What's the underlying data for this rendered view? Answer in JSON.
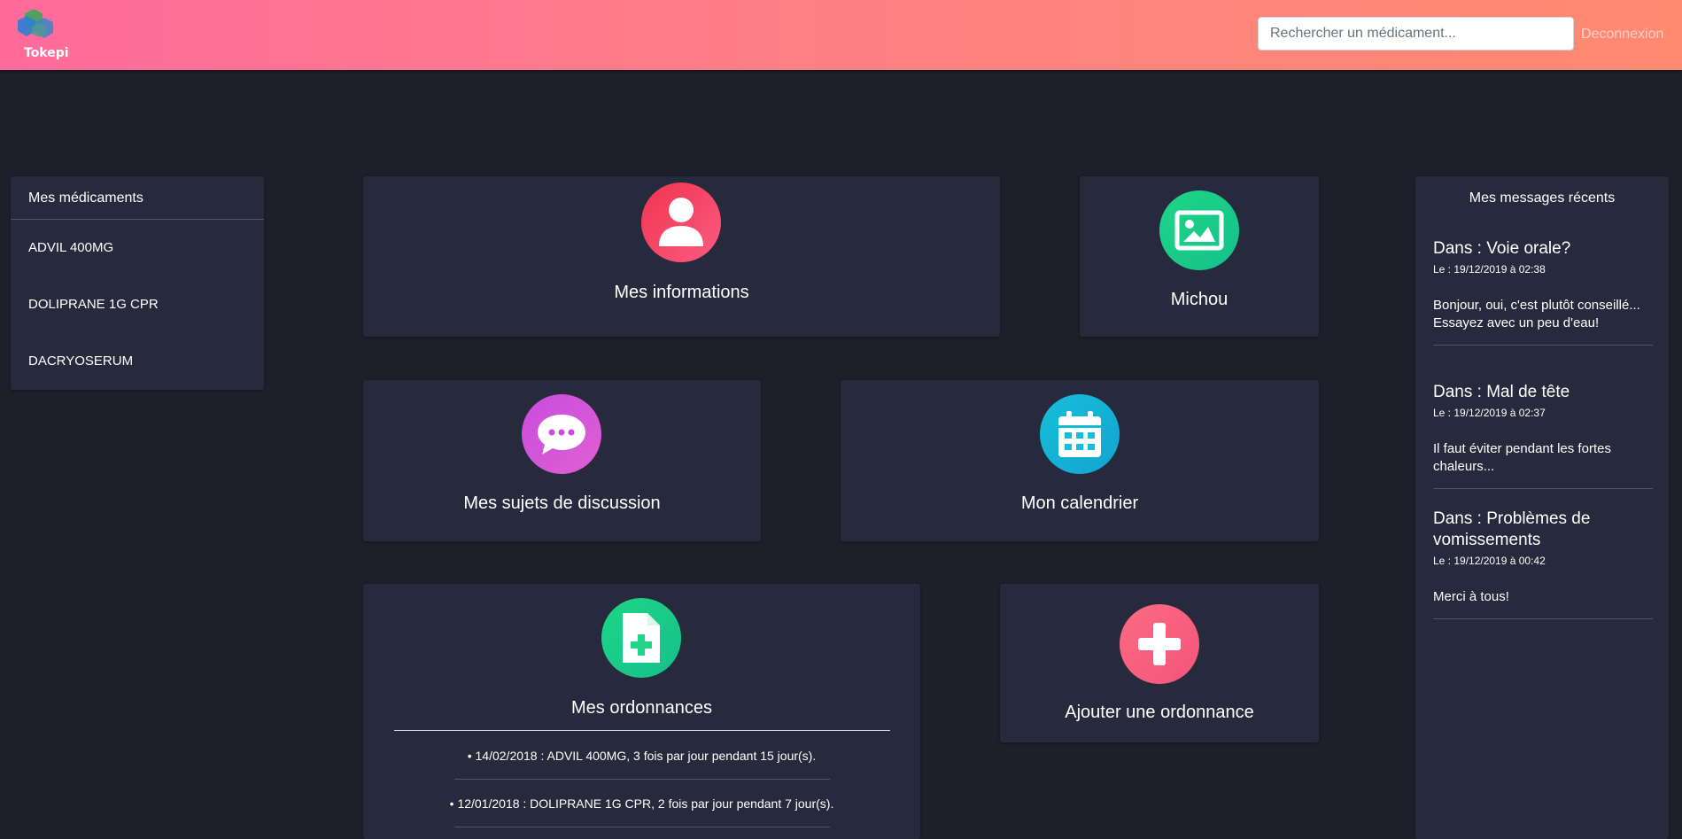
{
  "header": {
    "app_name": "Tokepi",
    "search_placeholder": "Rechercher un médicament...",
    "logout_label": "Deconnexion",
    "gradient_colors": [
      "#ff6a9b",
      "#ff8a70"
    ]
  },
  "medications": {
    "title": "Mes médicaments",
    "items": [
      "ADVIL 400MG",
      "DOLIPRANE 1G CPR",
      "DACRYOSERUM"
    ]
  },
  "tiles": {
    "informations": {
      "label": "Mes informations",
      "icon": "user-icon",
      "color": "#f0344f"
    },
    "profile": {
      "label": "Michou",
      "icon": "image-icon",
      "color": "#1ed685"
    },
    "topics": {
      "label": "Mes sujets de discussion",
      "icon": "chat-bubble-icon",
      "color": "#c84ce0"
    },
    "calendar": {
      "label": "Mon calendrier",
      "icon": "calendar-icon",
      "color": "#16bfd8"
    },
    "prescriptions": {
      "label": "Mes ordonnances",
      "icon": "prescription-file-icon",
      "color": "#1ed685",
      "items": [
        "• 14/02/2018 : ADVIL 400MG, 3 fois par jour pendant 15 jour(s).",
        "• 12/01/2018 : DOLIPRANE 1G CPR, 2 fois par jour pendant 7 jour(s)."
      ]
    },
    "add_prescription": {
      "label": "Ajouter une ordonnance",
      "icon": "plus-icon",
      "color": "#fb6b82"
    }
  },
  "messages": {
    "title": "Mes messages récents",
    "items": [
      {
        "subject": "Dans : Voie orale?",
        "date": "Le : 19/12/2019 à 02:38",
        "body": "Bonjour, oui, c'est plutôt conseillé... Essayez avec un peu d'eau!"
      },
      {
        "subject": "Dans : Mal de tête",
        "date": "Le : 19/12/2019 à 02:37",
        "body": "Il faut éviter pendant les fortes chaleurs..."
      },
      {
        "subject": "Dans : Problèmes de vomissements",
        "date": "Le : 19/12/2019 à 00:42",
        "body": "Merci à tous!"
      }
    ]
  }
}
